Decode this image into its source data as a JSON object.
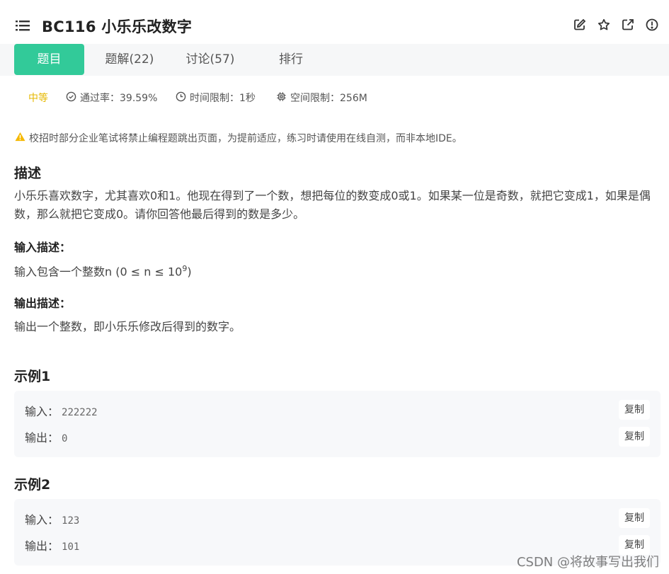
{
  "header": {
    "title": "BC116  小乐乐改数字"
  },
  "tabs": [
    {
      "label": "题目",
      "active": true
    },
    {
      "label": "题解(22)",
      "active": false
    },
    {
      "label": "讨论(57)",
      "active": false
    },
    {
      "label": "排行",
      "active": false
    }
  ],
  "meta": {
    "difficulty": "中等",
    "pass_rate": "通过率：39.59%",
    "time_limit": "时间限制：1秒",
    "space_limit": "空间限制：256M"
  },
  "warning": "校招时部分企业笔试将禁止编程题跳出页面，为提前适应，练习时请使用在线自测，而非本地IDE。",
  "description": {
    "heading": "描述",
    "text": "小乐乐喜欢数字，尤其喜欢0和1。他现在得到了一个数，想把每位的数变成0或1。如果某一位是奇数，就把它变成1，如果是偶数，那么就把它变成0。请你回答他最后得到的数是多少。"
  },
  "input_desc": {
    "heading": "输入描述：",
    "text_before": "输入包含一个整数n (0 ≤ n ≤ 10",
    "sup": "9",
    "text_after": ")"
  },
  "output_desc": {
    "heading": "输出描述：",
    "text": "输出一个整数，即小乐乐修改后得到的数字。"
  },
  "examples": [
    {
      "heading": "示例1",
      "input_label": "输入：",
      "input_value": "222222",
      "output_label": "输出：",
      "output_value": "0",
      "copy_label": "复制"
    },
    {
      "heading": "示例2",
      "input_label": "输入：",
      "input_value": "123",
      "output_label": "输出：",
      "output_value": "101",
      "copy_label": "复制"
    }
  ],
  "watermark": "CSDN @将故事写出我们",
  "colors": {
    "accent": "#32ca99",
    "difficulty": "#e6b800",
    "warning": "#f5b800"
  }
}
